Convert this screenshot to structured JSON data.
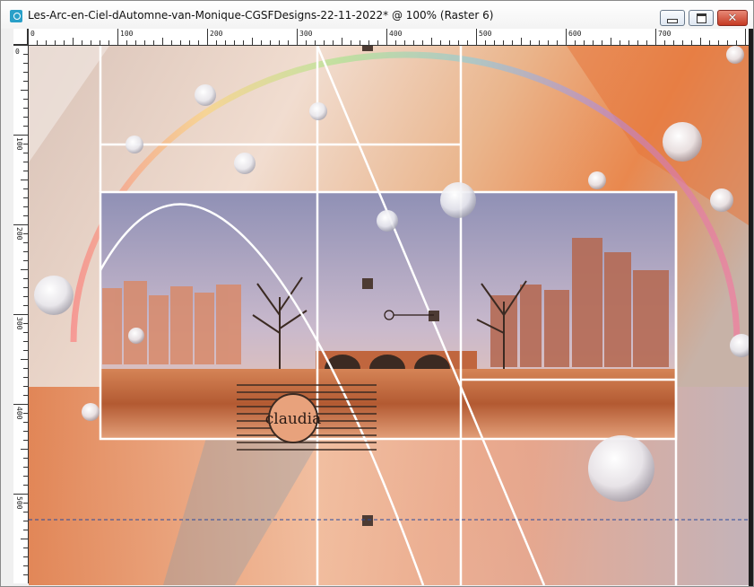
{
  "window": {
    "title": "Les-Arc-en-Ciel-dAutomne-van-Monique-CGSFDesigns-22-11-2022* @ 100% (Raster 6)",
    "icon": "paintshop-app-icon",
    "controls": {
      "minimize_icon": "minimize-icon",
      "maximize_icon": "maximize-icon",
      "close_glyph": "✕"
    }
  },
  "ruler": {
    "top_labels": [
      "0",
      "100",
      "200",
      "300",
      "400",
      "500",
      "600",
      "700"
    ],
    "left_labels": [
      "0",
      "100",
      "200",
      "300",
      "400",
      "500"
    ]
  },
  "canvas": {
    "watermark_text": "claudia",
    "colors": {
      "sky": "#8e8fae",
      "warm": "#e48a55",
      "orange": "#f0a070",
      "water": "#c9703c",
      "dark": "#3b2a22",
      "frame": "#ffffff"
    }
  }
}
